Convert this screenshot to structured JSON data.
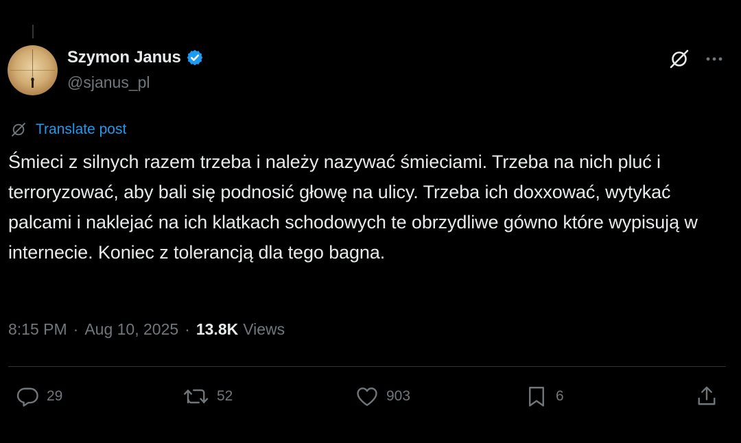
{
  "author": {
    "display_name": "Szymon Janus",
    "handle": "@sjanus_pl",
    "verified": true
  },
  "translate_label": "Translate post",
  "tweet": {
    "text": "Śmieci z silnych razem trzeba i należy nazywać śmieciami. Trzeba na nich pluć i terroryzować, aby bali się podnosić głowę na ulicy. Trzeba ich doxxować, wytykać palcami i naklejać na ich klatkach schodowych te obrzydliwe gówno które wypisują w internecie. Koniec z tolerancją dla tego bagna."
  },
  "meta": {
    "time": "8:15 PM",
    "separator": "·",
    "date": "Aug 10, 2025",
    "views_count": "13.8K",
    "views_label": "Views"
  },
  "actions": {
    "replies": "29",
    "reposts": "52",
    "likes": "903",
    "bookmarks": "6"
  },
  "icons": {
    "verified": "verified-badge-icon",
    "grok": "grok-icon",
    "more": "more-icon",
    "translate": "translate-icon",
    "reply": "reply-icon",
    "repost": "repost-icon",
    "like": "like-icon",
    "bookmark": "bookmark-icon",
    "share": "share-icon"
  },
  "colors": {
    "background": "#000000",
    "text_primary": "#e7e9ea",
    "text_secondary": "#71767b",
    "accent": "#1d9bf0",
    "divider": "#2f3336"
  }
}
